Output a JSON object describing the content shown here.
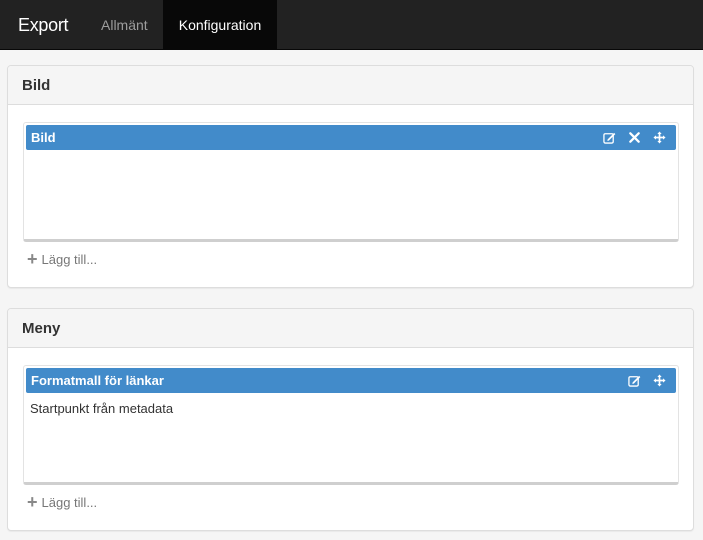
{
  "navbar": {
    "brand": "Export",
    "tabs": [
      {
        "label": "Allmänt",
        "active": false
      },
      {
        "label": "Konfiguration",
        "active": true
      }
    ]
  },
  "panels": [
    {
      "title": "Bild",
      "items": [
        {
          "label": "Bild",
          "content": "",
          "icons": [
            "edit-icon",
            "close-icon",
            "move-icon"
          ]
        }
      ],
      "add_label": "Lägg till..."
    },
    {
      "title": "Meny",
      "items": [
        {
          "label": "Formatmall för länkar",
          "content": "Startpunkt från metadata",
          "icons": [
            "edit-icon",
            "move-icon"
          ]
        }
      ],
      "add_label": "Lägg till..."
    }
  ],
  "colors": {
    "navbar_bg": "#222222",
    "active_tab_bg": "#080808",
    "item_bar": "#428bca"
  }
}
